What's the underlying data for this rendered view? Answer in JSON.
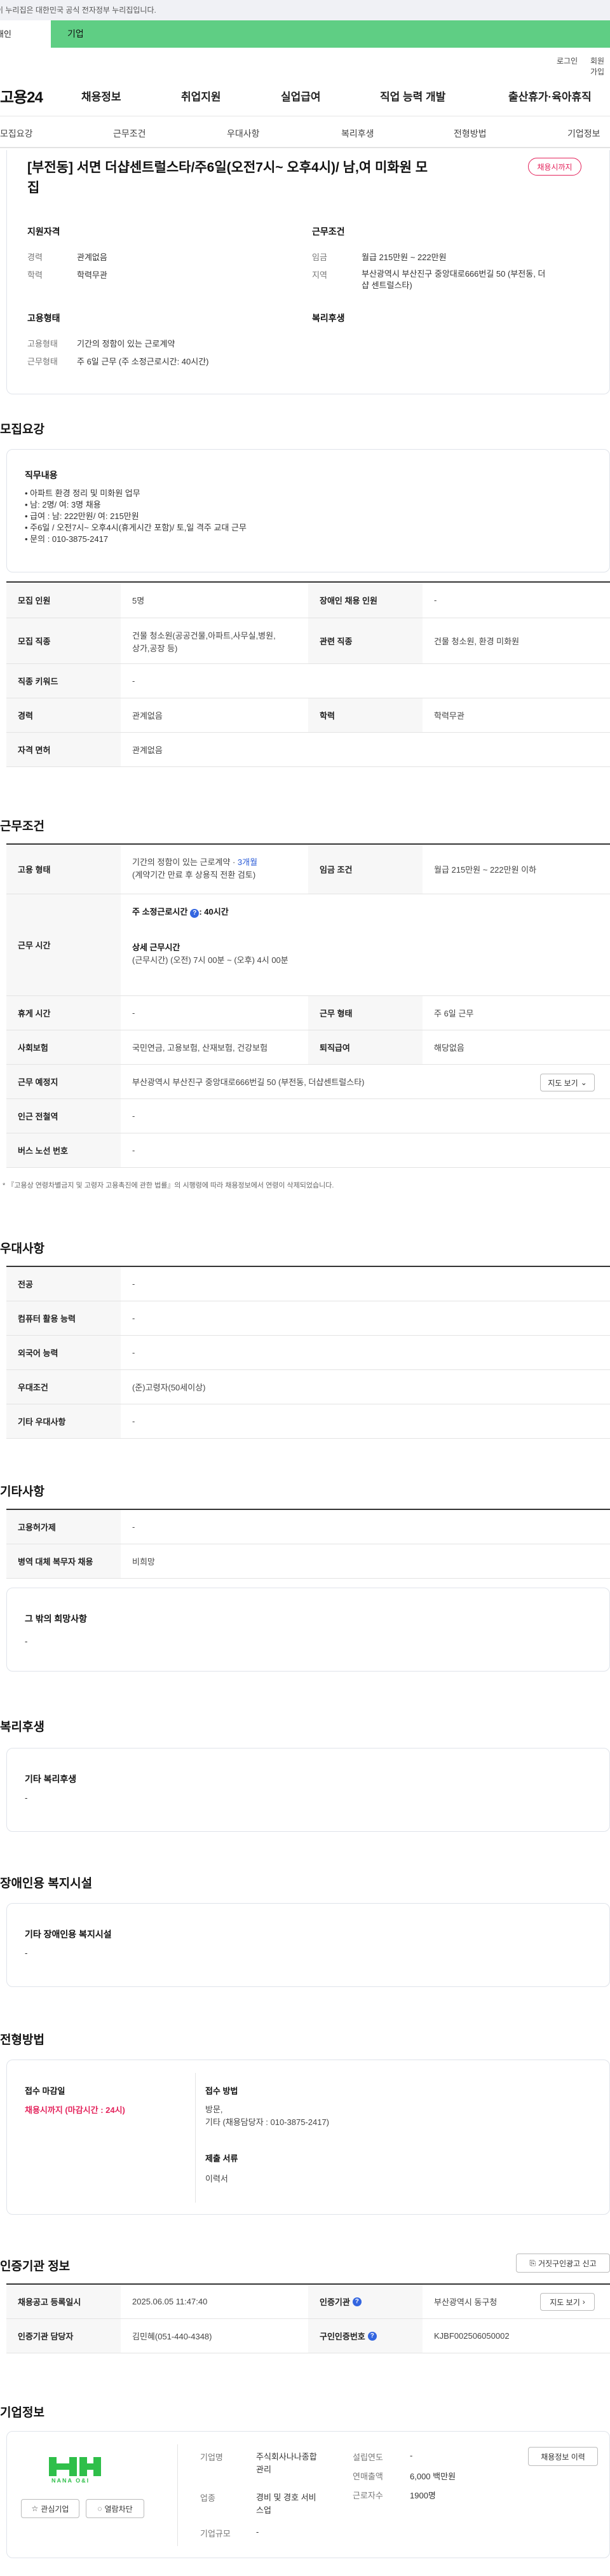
{
  "gov_banner": "이 누리집은 대한민국 공식 전자정부 누리집입니다.",
  "tabs": {
    "person": "개인",
    "company": "기업"
  },
  "util": {
    "login": "로그인",
    "join": "회원가입"
  },
  "logo": "고용24",
  "gnb": [
    "채용정보",
    "취업지원",
    "실업급여",
    "직업 능력 개발",
    "출산휴가·육아휴직"
  ],
  "subnav": [
    "모집요강",
    "근무조건",
    "우대사항",
    "복리후생",
    "전형방법",
    "기업정보"
  ],
  "summary": {
    "title_line1": "[부전동] 서면 더샵센트럴스타/주6일(오전7시~ 오후4시)/ 남,여 미화원 모",
    "title_line2": "집",
    "status_badge": "채용시까지",
    "qual_title": "지원자격",
    "qual": [
      {
        "label": "경력",
        "value": "관계없음"
      },
      {
        "label": "학력",
        "value": "학력무관"
      }
    ],
    "cond_title": "근무조건",
    "cond": [
      {
        "label": "임금",
        "value": "월급 215만원 ~ 222만원"
      },
      {
        "label": "지역",
        "value_line1": "부산광역시 부산진구 중앙대로666번길 50 (부전동, 더",
        "value_line2": "샵 센트럴스타)"
      }
    ],
    "form_title": "고용형태",
    "form": [
      {
        "label": "고용형태",
        "value": "기간의 정함이 있는 근로계약"
      },
      {
        "label": "근무형태",
        "value": "주 6일 근무 (주 소정근로시간: 40시간)"
      }
    ],
    "welfare_title": "복리후생"
  },
  "recruit": {
    "section_title": "모집요강",
    "duty_title": "직무내용",
    "duty_lines": [
      "• 아파트 환경 정리 및 미화원 업무",
      "• 남: 2명/ 여: 3명 채용",
      "• 급여 : 남: 222만원/ 여: 215만원",
      "• 주6일 / 오전7시~ 오후4시(휴게시간 포함)/ 토,일 격주 교대 근무",
      "• 문의 : 010-3875-2417"
    ],
    "rows": {
      "headcount_label": "모집 인원",
      "headcount": "5명",
      "disabled_label": "장애인 채용 인원",
      "disabled": "-",
      "job_label": "모집 직종",
      "job_line1": "건물 청소원(공공건물,아파트,사무실,병원,",
      "job_line2": "상가,공장 등)",
      "related_label": "관련 직종",
      "related": "건물 청소원, 환경 미화원",
      "keyword_label": "직종 키워드",
      "keyword": "-",
      "career_label": "경력",
      "career": "관계없음",
      "edu_label": "학력",
      "edu": "학력무관",
      "license_label": "자격 면허",
      "license": "관계없음"
    }
  },
  "workcond": {
    "section_title": "근무조건",
    "emp_type_label": "고용 형태",
    "emp_type_line1": "기간의 정함이 있는 근로계약 · ",
    "emp_type_months": "3개월",
    "emp_type_line2": "(계약기간 만료 후 상용직 전환 검토)",
    "wage_label": "임금 조건",
    "wage": "월급 215만원 ~ 222만원 이하",
    "hours_label": "근무 시간",
    "hours_weekly_label": "주 소정근로시간",
    "hours_weekly": ": 40시간",
    "hours_detail_title": "상세 근무시간",
    "hours_detail": "(근무시간) (오전) 7시 00분 ~ (오후) 4시 00분",
    "break_label": "휴게 시간",
    "break": "-",
    "shift_label": "근무 형태",
    "shift": "주 6일 근무",
    "insurance_label": "사회보험",
    "insurance": "국민연금, 고용보험, 산재보험, 건강보험",
    "retire_label": "퇴직급여",
    "retire": "해당없음",
    "place_label": "근무 예정지",
    "place": "부산광역시 부산진구 중앙대로666번길 50 (부전동, 더샵센트럴스타)",
    "map_button": "지도 보기",
    "station_label": "인근 전철역",
    "station": "-",
    "bus_label": "버스 노선 번호",
    "bus": "-",
    "note": "* 『고용상 연령차별금지 및 고령자 고용촉진에 관한 법률』의 시행령에 따라 채용정보에서 연령이 삭제되었습니다."
  },
  "preference": {
    "section_title": "우대사항",
    "rows": [
      {
        "label": "전공",
        "value": "-"
      },
      {
        "label": "컴퓨터 활용 능력",
        "value": "-"
      },
      {
        "label": "외국어 능력",
        "value": "-"
      },
      {
        "label": "우대조건",
        "value": "(준)고령자(50세이상)"
      },
      {
        "label": "기타 우대사항",
        "value": "-"
      }
    ]
  },
  "etc": {
    "section_title": "기타사항",
    "rows": [
      {
        "label": "고용허가제",
        "value": "-"
      },
      {
        "label": "병역 대체 복무자 채용",
        "value": "비희망"
      }
    ],
    "other_title": "그 밖의 희망사항",
    "other_value": "-"
  },
  "welfare": {
    "section_title": "복리후생",
    "box_title": "기타 복리후생",
    "box_value": "-"
  },
  "accessibility": {
    "section_title": "장애인용 복지시설",
    "box_title": "기타 장애인용 복지시설",
    "box_value": "-"
  },
  "selection": {
    "section_title": "전형방법",
    "deadline_title": "접수 마감일",
    "deadline_value": "채용시까지 (마감시간 : 24시)",
    "method_title": "접수 방법",
    "method_line1": "방문,",
    "method_line2": "기타 (채용담당자 : 010-3875-2417)",
    "docs_title": "제출 서류",
    "docs_value": "이력서"
  },
  "cert": {
    "section_title": "인증기관 정보",
    "report_button": "거짓구인광고 신고",
    "reg_date_label": "채용공고 등록일시",
    "reg_date": "2025.06.05 11:47:40",
    "agency_label": "인증기관",
    "agency": "부산광역시 동구청",
    "map_button": "지도 보기",
    "manager_label": "인증기관 담당자",
    "manager": "김민혜(051-440-4348)",
    "notice_label": "구인인증번호",
    "notice": "KJBF002506050002"
  },
  "company": {
    "section_title": "기업정보",
    "logo_text": "NANA O&I",
    "interest_button": "관심기업",
    "block_button": "열람차단",
    "name_label": "기업명",
    "name_line1": "주식회사나나종합",
    "name_line2": "관리",
    "industry_label": "업종",
    "industry_line1": "경비 및 경호 서비",
    "industry_line2": "스업",
    "size_label": "기업규모",
    "size": "-",
    "founded_label": "설립연도",
    "founded": "-",
    "revenue_label": "연매출액",
    "revenue": "6,000 백만원",
    "employees_label": "근로자수",
    "employees": "1900명",
    "history_button": "채용정보 이력"
  }
}
